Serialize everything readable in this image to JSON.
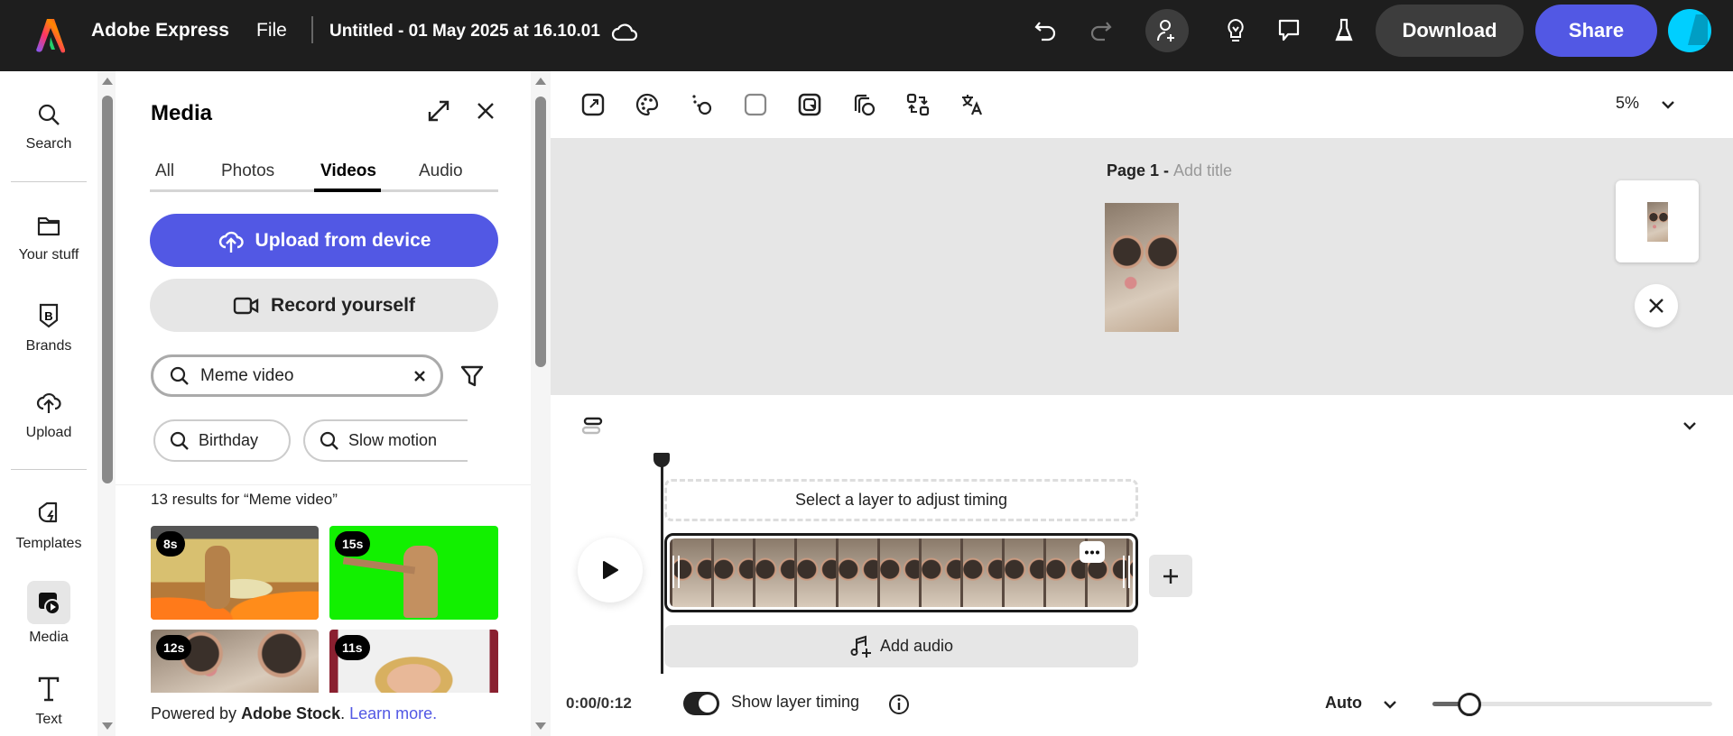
{
  "topbar": {
    "app_name": "Adobe Express",
    "file_menu": "File",
    "doc_title": "Untitled - 01 May 2025 at 16.10.01",
    "download": "Download",
    "share": "Share",
    "colors": {
      "share": "#5258e4",
      "download": "#3d3d3d"
    }
  },
  "rail": {
    "items": [
      {
        "label": "Search",
        "icon": "search-icon"
      },
      {
        "label": "Your stuff",
        "icon": "folder-icon"
      },
      {
        "label": "Brands",
        "icon": "brand-icon"
      },
      {
        "label": "Upload",
        "icon": "upload-cloud-icon"
      },
      {
        "label": "Templates",
        "icon": "templates-icon"
      },
      {
        "label": "Media",
        "icon": "media-icon"
      },
      {
        "label": "Text",
        "icon": "text-icon"
      }
    ]
  },
  "panel": {
    "title": "Media",
    "tabs": [
      "All",
      "Photos",
      "Videos",
      "Audio"
    ],
    "active_tab": "Videos",
    "upload_btn": "Upload from device",
    "record_btn": "Record yourself",
    "search_value": "Meme video",
    "chips": [
      "Birthday",
      "Slow motion"
    ],
    "results_text": "13 results for “Meme video”",
    "results": [
      {
        "duration": "8s"
      },
      {
        "duration": "15s"
      },
      {
        "duration": "12s"
      },
      {
        "duration": "11s"
      }
    ],
    "footer_prefix": "Powered by ",
    "footer_brand": "Adobe Stock",
    "footer_dot": ".",
    "footer_link": "Learn more."
  },
  "toolbar": {
    "zoom": "5%"
  },
  "canvas": {
    "page_label": "Page 1 - ",
    "page_title_placeholder": "Add title"
  },
  "timeline": {
    "hint": "Select a layer to adjust timing",
    "add_audio": "Add audio",
    "time": "0:00/0:12",
    "show_layer_timing": "Show layer timing",
    "toggle_on": true,
    "scale_mode": "Auto",
    "zoom_slider_fraction": 0.1
  }
}
